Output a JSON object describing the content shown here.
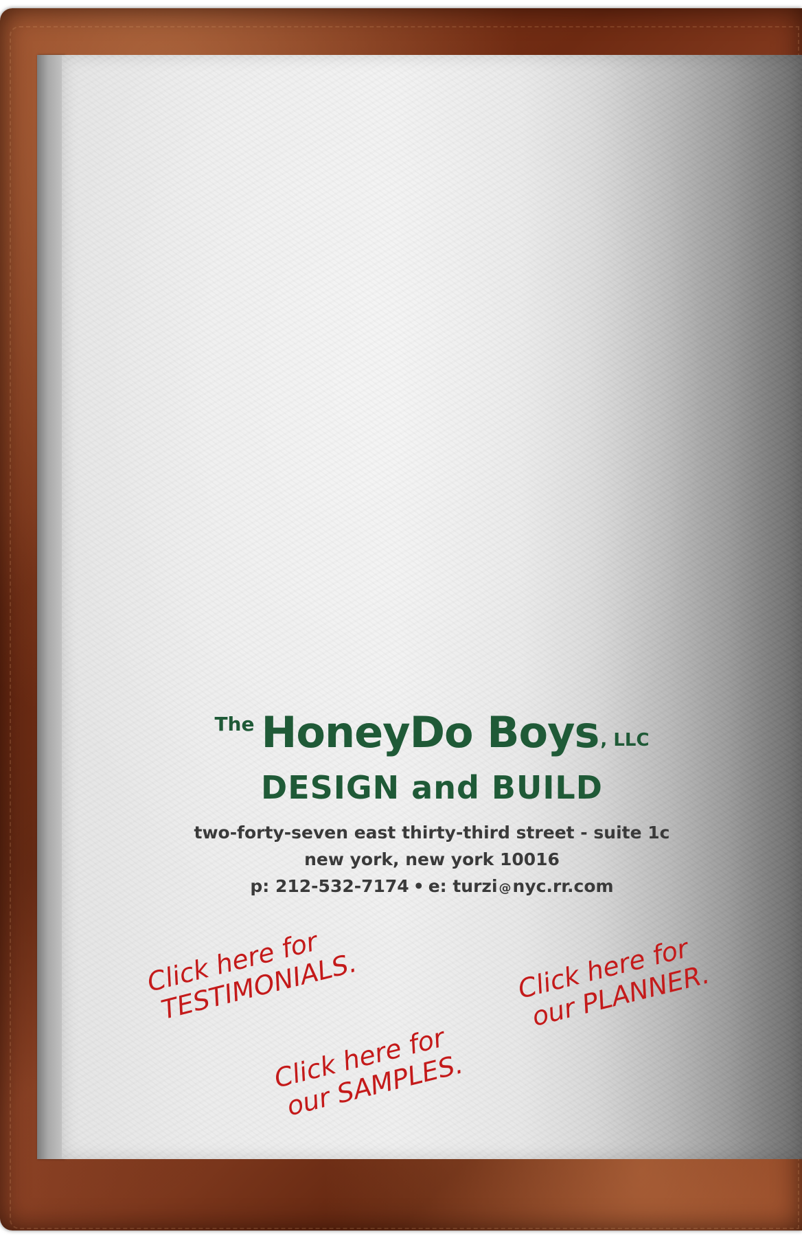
{
  "logo": {
    "the": "The",
    "name": "HoneyDo Boys",
    "llc": ", LLC",
    "subtitle": "DESIGN and BUILD"
  },
  "address": {
    "street": "two-forty-seven east thirty-third street - suite 1c",
    "city": "new york, new york 10016",
    "phone": "p: 212-532-7174",
    "bullet": "•",
    "email_label": "e: turzi",
    "email_at": "@",
    "email_domain": "nyc.rr.com"
  },
  "links": {
    "testimonials": {
      "line1": "Click here for",
      "line2": "TESTIMONIALS."
    },
    "samples": {
      "line1": "Click here for",
      "line2": "our SAMPLES."
    },
    "planner": {
      "line1": "Click here for",
      "line2": "our PLANNER."
    }
  },
  "colors": {
    "logo_green": "#1f5a37",
    "link_red": "#c41a1a",
    "leather": "#7a3418",
    "paper": "#ececec"
  }
}
